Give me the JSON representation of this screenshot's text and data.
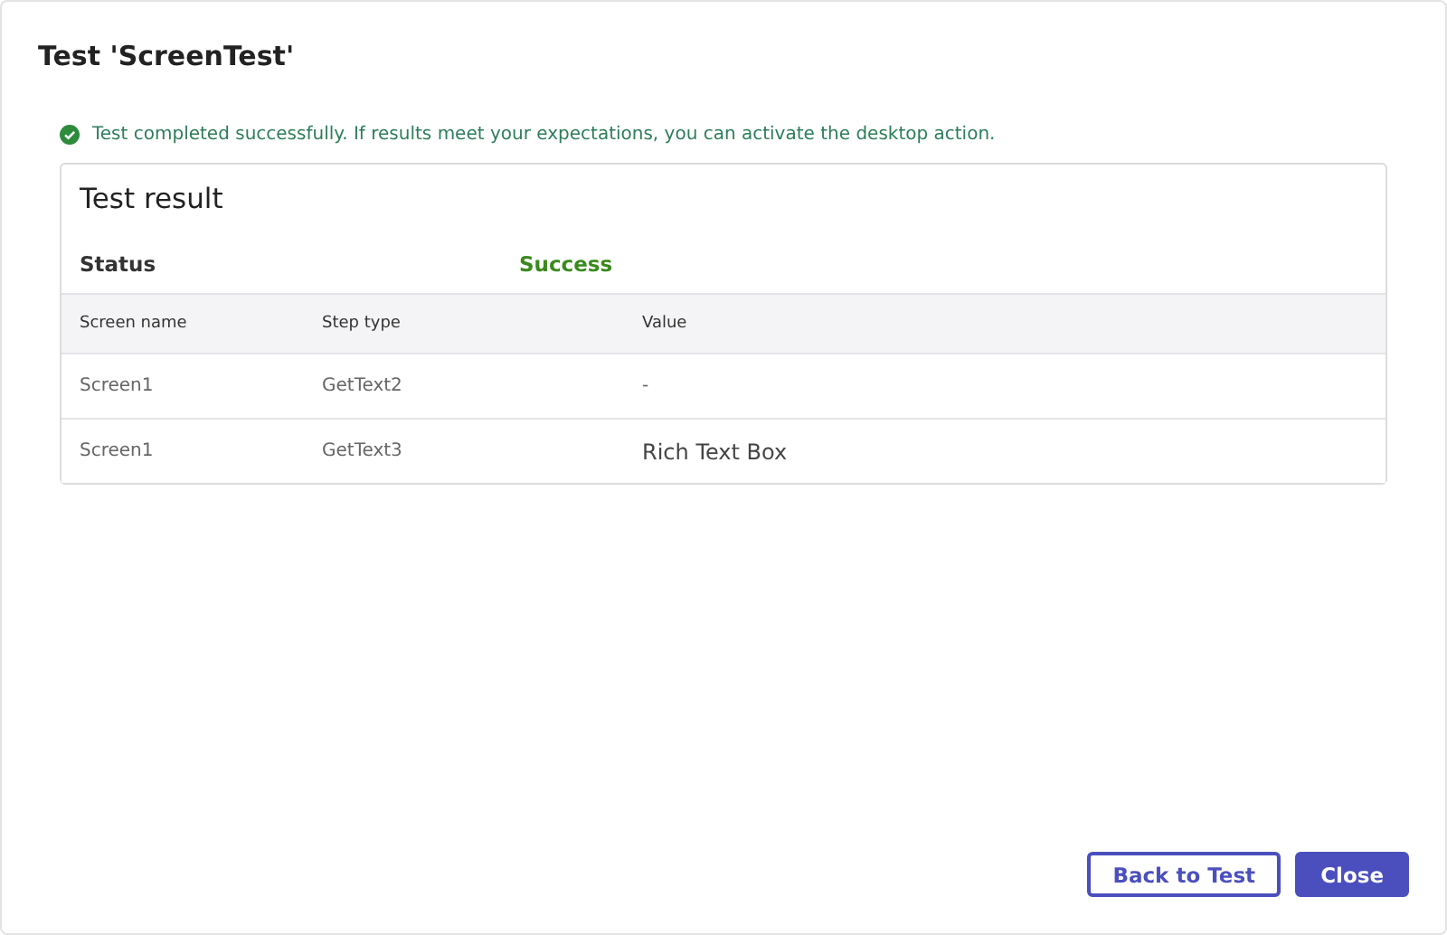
{
  "dialog": {
    "title": "Test 'ScreenTest'"
  },
  "message": {
    "text": "Test completed successfully. If results meet your expectations, you can activate the desktop action."
  },
  "result": {
    "title": "Test result",
    "status_label": "Status",
    "status_value": "Success",
    "table": {
      "columns": [
        "Screen name",
        "Step type",
        "Value"
      ],
      "rows": [
        {
          "cells": [
            "Screen1",
            "GetText2",
            "-"
          ]
        },
        {
          "cells": [
            "Screen1",
            "GetText3",
            "Rich Text Box"
          ]
        }
      ]
    }
  },
  "buttons": [
    {
      "label": "Back to Test",
      "kind": "secondary"
    },
    {
      "label": "Close",
      "kind": "primary"
    }
  ]
}
